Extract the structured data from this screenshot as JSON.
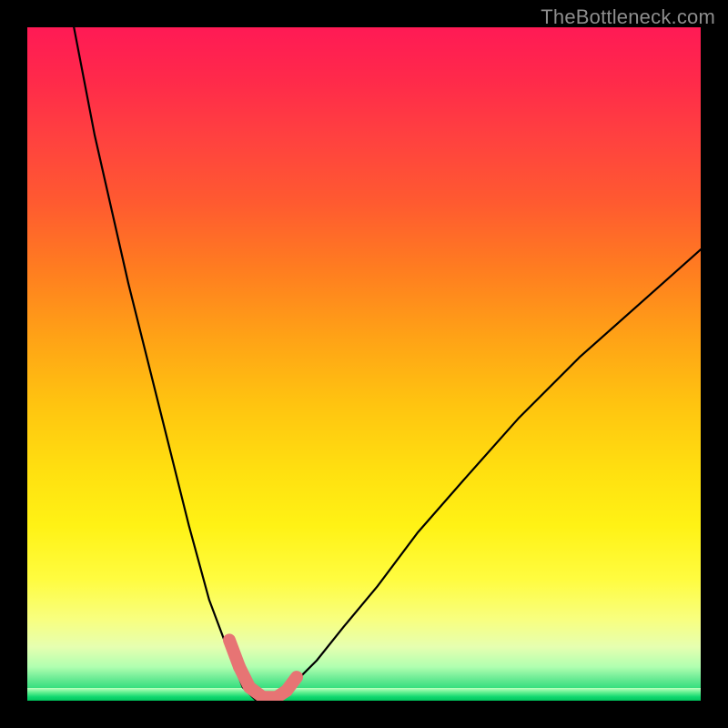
{
  "watermark": "TheBottleneck.com",
  "chart_data": {
    "type": "line",
    "title": "",
    "xlabel": "",
    "ylabel": "",
    "xlim": [
      0,
      100
    ],
    "ylim": [
      0,
      100
    ],
    "grid": false,
    "legend": false,
    "notes": "Curve shows bottleneck percentage; minimum (optimal) near x≈35 where y≈0. Background gradient red→yellow→green indicates severity (red=high, green=none). Pink segmented marker highlights the optimal range at the minimum.",
    "series": [
      {
        "name": "bottleneck curve",
        "x": [
          0,
          5,
          10,
          15,
          20,
          24,
          27,
          30,
          32,
          34,
          35,
          36,
          38,
          40,
          43,
          47,
          52,
          58,
          65,
          73,
          82,
          91,
          100
        ],
        "y": [
          140,
          110,
          84,
          62,
          42,
          26,
          15,
          7,
          2,
          0,
          0,
          0,
          1,
          3,
          6,
          11,
          17,
          25,
          33,
          42,
          51,
          59,
          67
        ]
      }
    ],
    "highlight_segments": {
      "name": "optimal-range marker",
      "points_x": [
        30,
        31.5,
        33,
        35,
        37,
        38.5,
        40
      ],
      "points_y": [
        9,
        5,
        2,
        0.5,
        0.5,
        1.5,
        3.5
      ]
    },
    "colors": {
      "gradient_top": "#ff1a55",
      "gradient_mid": "#ffe010",
      "gradient_bottom": "#00c860",
      "curve": "#000000",
      "marker": "#e77474",
      "frame": "#000000"
    }
  }
}
